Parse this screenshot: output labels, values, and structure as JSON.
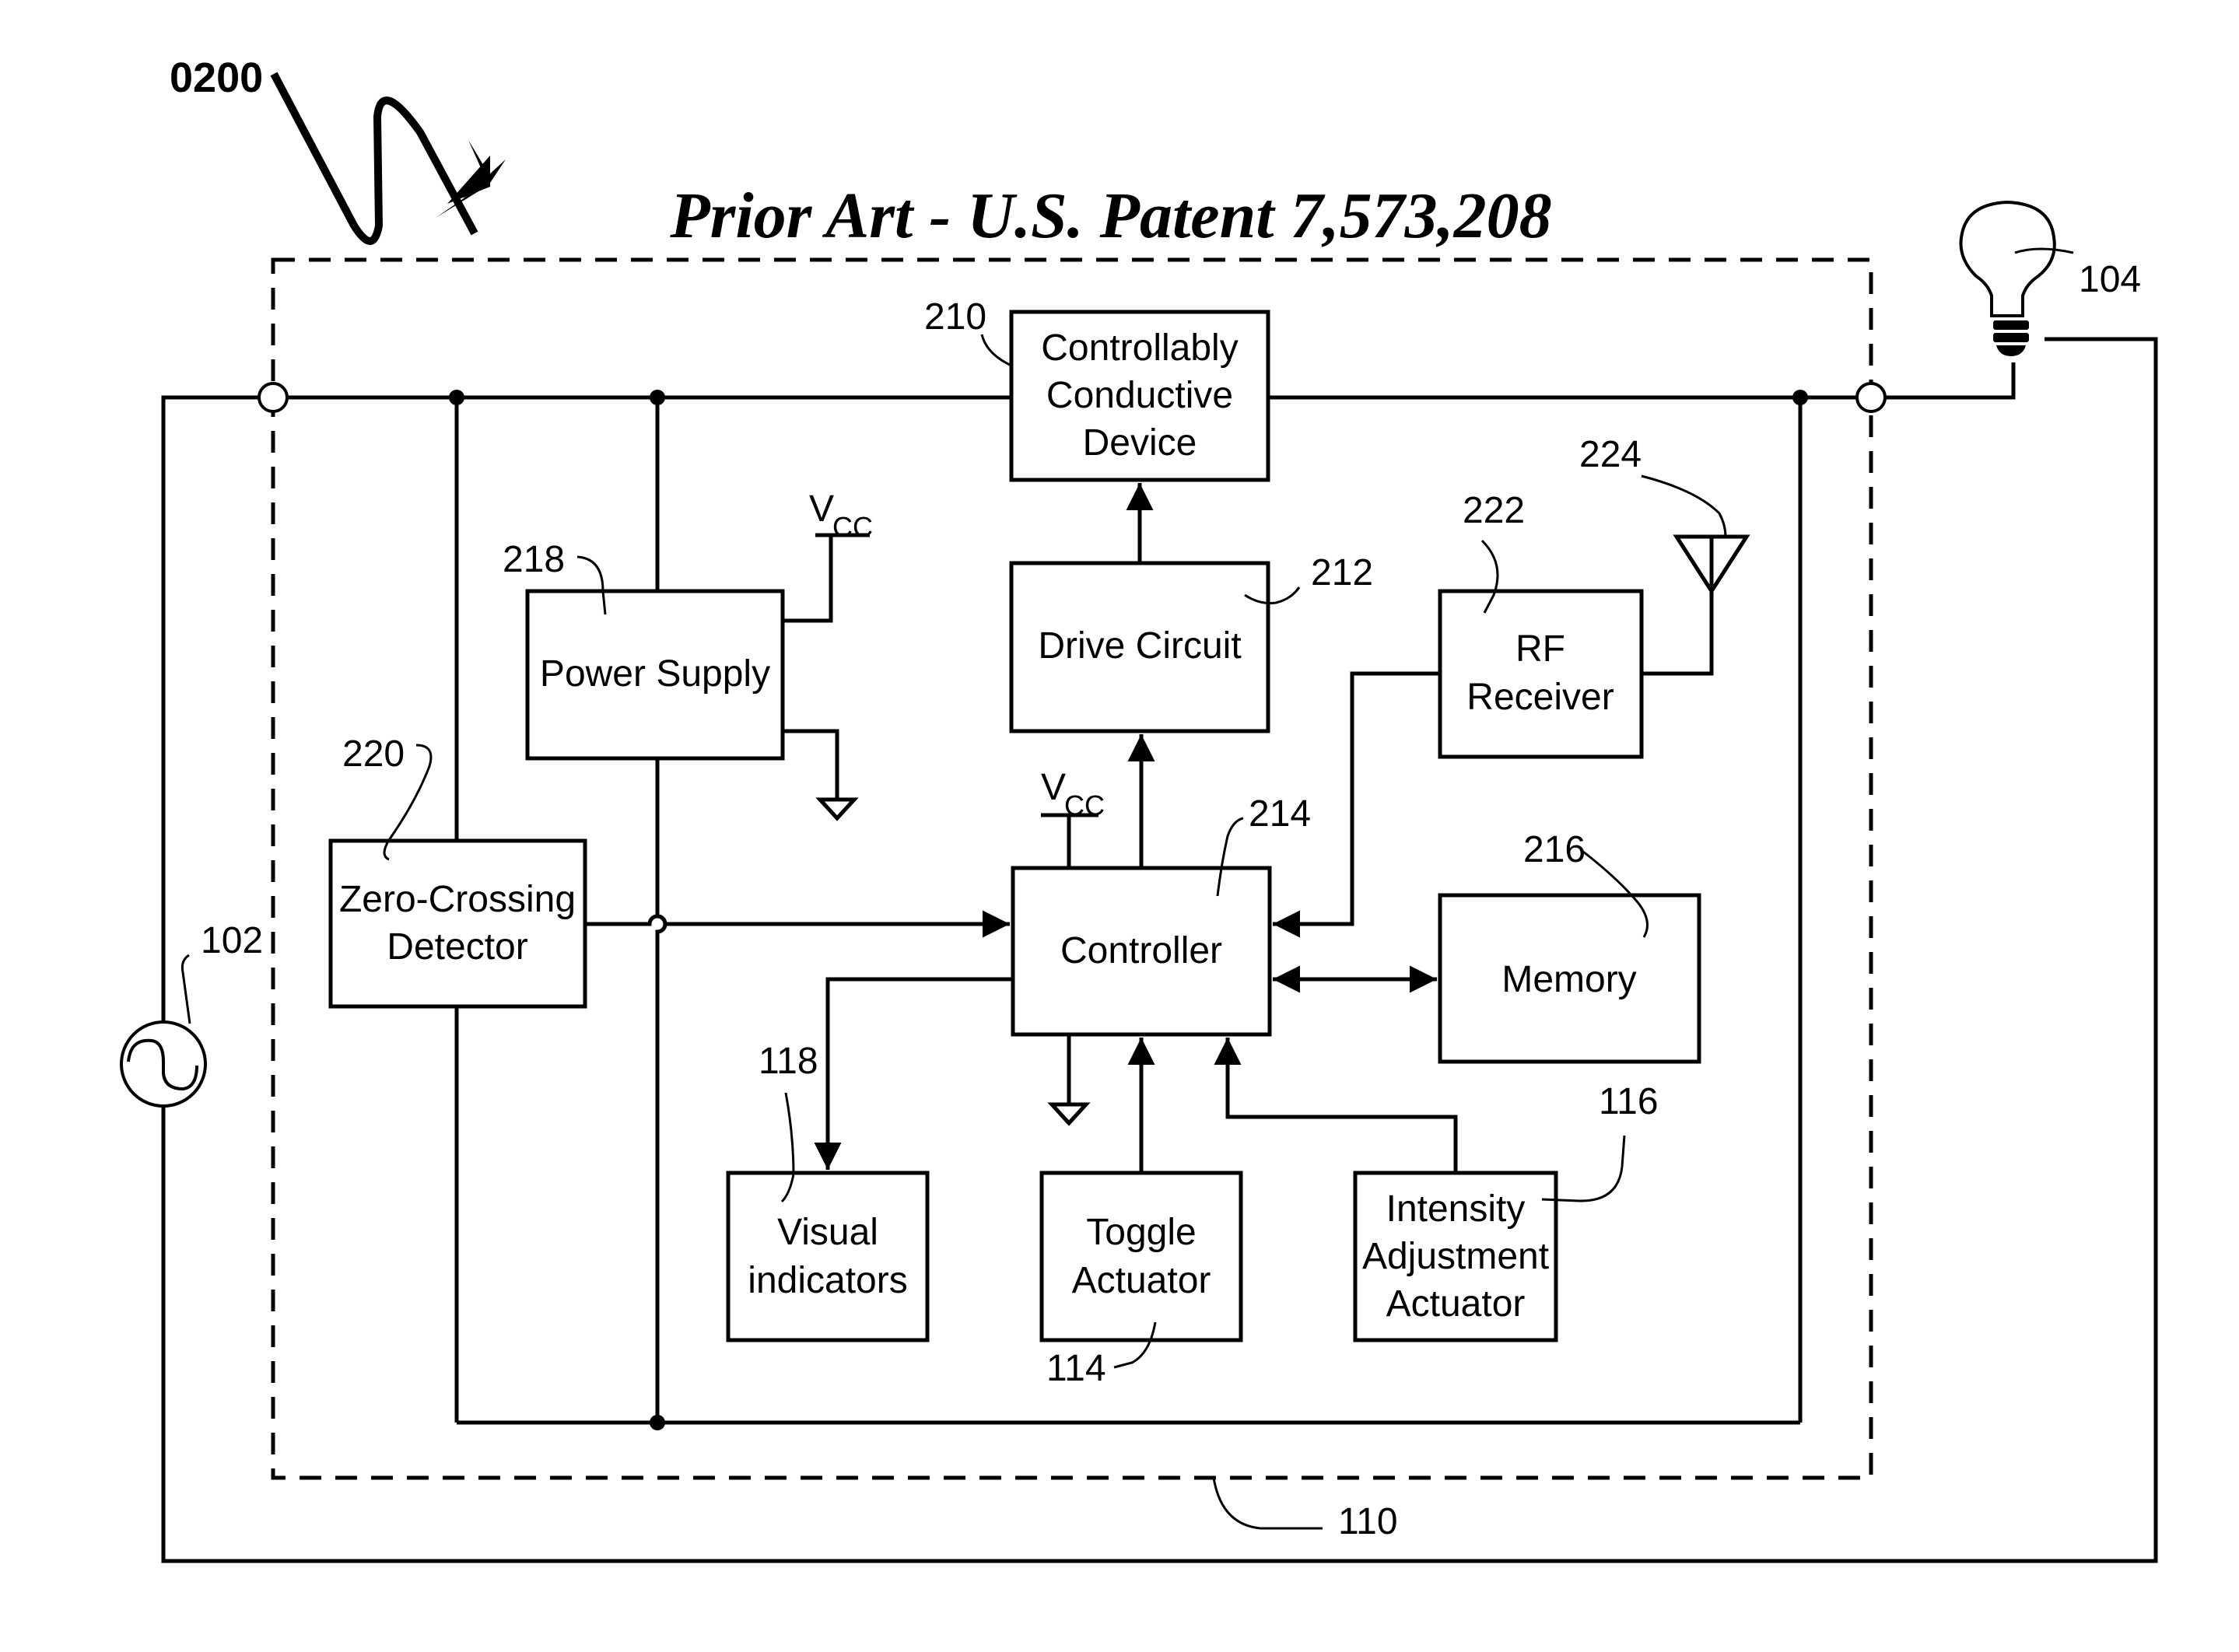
{
  "figure": {
    "figure_ref": "0200",
    "title": "Prior Art - U.S. Patent 7,573,208",
    "enclosure_ref": "110"
  },
  "blocks": {
    "ccd": {
      "lines": [
        "Controllably",
        "Conductive",
        "Device"
      ],
      "ref": "210"
    },
    "drive": {
      "lines": [
        "Drive Circuit"
      ],
      "ref": "212"
    },
    "controller": {
      "lines": [
        "Controller"
      ],
      "ref": "214"
    },
    "memory": {
      "lines": [
        "Memory"
      ],
      "ref": "216"
    },
    "power": {
      "lines": [
        "Power Supply"
      ],
      "ref": "218"
    },
    "zcd": {
      "lines": [
        "Zero-Crossing",
        "Detector"
      ],
      "ref": "220"
    },
    "rf": {
      "lines": [
        "RF",
        "Receiver"
      ],
      "ref": "222"
    },
    "visual": {
      "lines": [
        "Visual",
        "indicators"
      ],
      "ref": "118"
    },
    "toggle": {
      "lines": [
        "Toggle",
        "Actuator"
      ],
      "ref": "114"
    },
    "intensity": {
      "lines": [
        "Intensity",
        "Adjustment",
        "Actuator"
      ],
      "ref": "116"
    }
  },
  "components": {
    "ac_source": {
      "ref": "102",
      "icon": "ac-source-icon"
    },
    "lamp": {
      "ref": "104",
      "icon": "light-bulb-icon"
    },
    "antenna": {
      "ref": "224",
      "icon": "antenna-icon"
    },
    "vcc_label": "V",
    "vcc_sub": "CC"
  }
}
